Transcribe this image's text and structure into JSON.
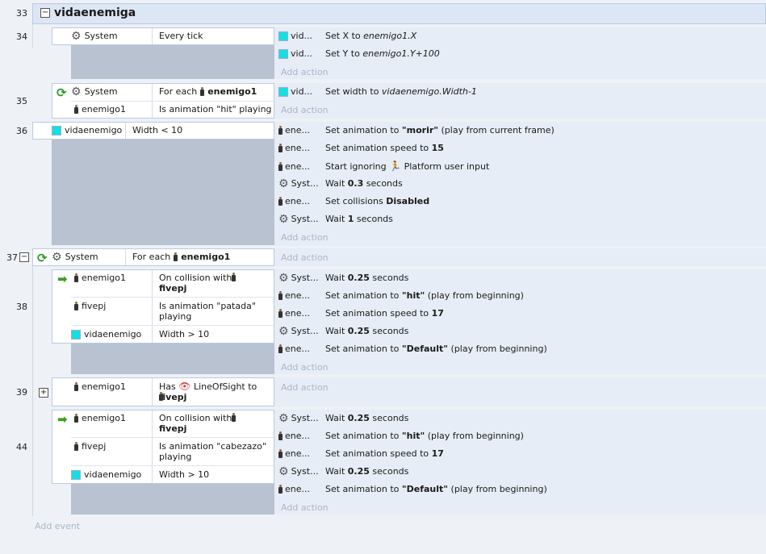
{
  "group": {
    "line": "33",
    "title": "vidaenemiga",
    "toggle": "−"
  },
  "events": {
    "e34": {
      "line": "34",
      "conditions": [
        {
          "object": "System",
          "text": "Every tick"
        }
      ],
      "actions": [
        {
          "object": "vid...",
          "text_html": "Set X to <i>enemigo1.X</i>"
        },
        {
          "object": "vid...",
          "text_html": "Set Y to <i>enemigo1.Y+100</i>"
        }
      ],
      "add_action": "Add action"
    },
    "e35": {
      "line": "35",
      "conditions": [
        {
          "object": "System",
          "text_html": "For each <span class=\"person\"></span> <b>enemigo1</b>"
        },
        {
          "object": "enemigo1",
          "text": "Is animation \"hit\" playing"
        }
      ],
      "actions": [
        {
          "object": "vid...",
          "text_html": "Set width to <i>vidaenemigo.Width-1</i>"
        }
      ],
      "add_action": "Add action"
    },
    "e36": {
      "line": "36",
      "conditions": [
        {
          "object": "vidaenemigo",
          "text": "Width < 10"
        }
      ],
      "actions": [
        {
          "object": "ene...",
          "text_html": "Set animation to <b>\"morir\"</b> (play from current frame)"
        },
        {
          "object": "ene...",
          "text_html": "Set animation speed to <b>15</b>"
        },
        {
          "object": "ene...",
          "text_html": "Start ignoring <span class=\"plat\">🏃</span> Platform user input"
        },
        {
          "object": "Syst...",
          "text_html": "Wait <b>0.3</b> seconds"
        },
        {
          "object": "ene...",
          "text_html": "Set collisions <b>Disabled</b>"
        },
        {
          "object": "Syst...",
          "text_html": "Wait <b>1</b> seconds"
        }
      ],
      "add_action": "Add action"
    },
    "e37": {
      "line": "37",
      "toggle": "−",
      "conditions": [
        {
          "object": "System",
          "text_html": "For each <span class=\"person\"></span> <b>enemigo1</b>"
        }
      ],
      "add_action": "Add action"
    },
    "e38": {
      "line": "38",
      "conditions": [
        {
          "object": "enemigo1",
          "text_html": "On collision with <span class=\"person\"></span><br><b>fivepj</b>"
        },
        {
          "object": "fivepj",
          "text_html": "Is animation \"patada\"<br>playing"
        },
        {
          "object": "vidaenemigo",
          "text": "Width > 10"
        }
      ],
      "actions": [
        {
          "object": "Syst...",
          "text_html": "Wait <b>0.25</b> seconds"
        },
        {
          "object": "ene...",
          "text_html": "Set animation to <b>\"hit\"</b> (play from beginning)"
        },
        {
          "object": "ene...",
          "text_html": "Set animation speed to <b>17</b>"
        },
        {
          "object": "Syst...",
          "text_html": "Wait <b>0.25</b> seconds"
        },
        {
          "object": "ene...",
          "text_html": "Set animation to <b>\"Default\"</b> (play from beginning)"
        }
      ],
      "add_action": "Add action"
    },
    "e39": {
      "line": "39",
      "toggle": "+",
      "conditions": [
        {
          "object": "enemigo1",
          "text_html": "Has <span class=\"eye\">👁</span> LineOfSight to<br><span class=\"person\"></span> <b>fivepj</b>"
        }
      ],
      "add_action": "Add action"
    },
    "e44": {
      "line": "44",
      "conditions": [
        {
          "object": "enemigo1",
          "text_html": "On collision with <span class=\"person\"></span><br><b>fivepj</b>"
        },
        {
          "object": "fivepj",
          "text_html": "Is animation \"cabezazo\"<br>playing"
        },
        {
          "object": "vidaenemigo",
          "text": "Width > 10"
        }
      ],
      "actions": [
        {
          "object": "Syst...",
          "text_html": "Wait <b>0.25</b> seconds"
        },
        {
          "object": "ene...",
          "text_html": "Set animation to <b>\"hit\"</b> (play from beginning)"
        },
        {
          "object": "ene...",
          "text_html": "Set animation speed to <b>17</b>"
        },
        {
          "object": "Syst...",
          "text_html": "Wait <b>0.25</b> seconds"
        },
        {
          "object": "ene...",
          "text_html": "Set animation to <b>\"Default\"</b> (play from beginning)"
        }
      ],
      "add_action": "Add action"
    }
  },
  "add_event": "Add event",
  "colors": {
    "sprite_square": "#14e0e0",
    "group_header": "#dce6f4",
    "action_bg": "#e7edf6",
    "empty_cond": "#b9c2d1"
  }
}
